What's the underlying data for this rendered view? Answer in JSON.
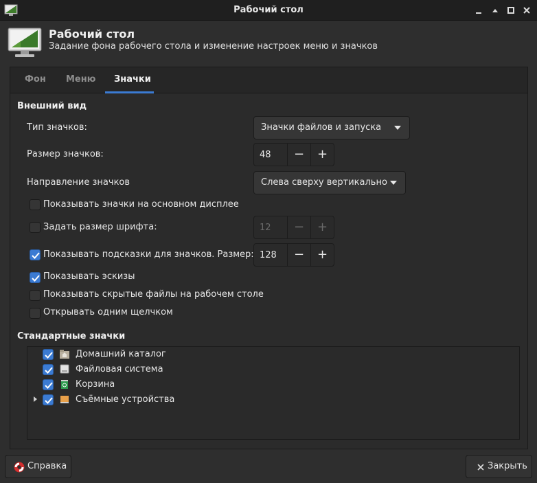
{
  "window": {
    "title": "Рабочий стол"
  },
  "header": {
    "title": "Рабочий стол",
    "subtitle": "Задание фона рабочего стола и изменение настроек меню и значков",
    "icon": "desktop-monitor-icon"
  },
  "tabs": [
    {
      "label": "Фон",
      "active": false
    },
    {
      "label": "Меню",
      "active": false
    },
    {
      "label": "Значки",
      "active": true
    }
  ],
  "appearance": {
    "section_title": "Внешний вид",
    "icon_type_label": "Тип значков:",
    "icon_type_value": "Значки файлов и запуска",
    "icon_size_label": "Размер значков:",
    "icon_size_value": "48",
    "direction_label": "Направление значков",
    "direction_value": "Слева сверху вертикально",
    "show_on_primary": {
      "label": "Показывать значки на основном дисплее",
      "checked": false
    },
    "font_size": {
      "label": "Задать размер шрифта:",
      "checked": false,
      "value": "12"
    },
    "tooltips": {
      "label": "Показывать подсказки для значков. Размер:",
      "checked": true,
      "value": "128"
    },
    "thumbnails": {
      "label": "Показывать эскизы",
      "checked": true
    },
    "hidden_files": {
      "label": "Показывать скрытые файлы на рабочем столе",
      "checked": false
    },
    "single_click": {
      "label": "Открывать одним щелчком",
      "checked": false
    }
  },
  "standard_icons": {
    "section_title": "Стандартные значки",
    "items": [
      {
        "label": "Домашний каталог",
        "checked": true,
        "icon": "home-folder-icon"
      },
      {
        "label": "Файловая система",
        "checked": true,
        "icon": "filesystem-drive-icon"
      },
      {
        "label": "Корзина",
        "checked": true,
        "icon": "trash-icon"
      },
      {
        "label": "Съёмные устройства",
        "checked": true,
        "icon": "removable-drive-icon",
        "expandable": true
      }
    ]
  },
  "buttons": {
    "help": "Справка",
    "close": "Закрыть"
  },
  "colors": {
    "accent": "#3b7bd3",
    "background": "#2e2e2e"
  }
}
